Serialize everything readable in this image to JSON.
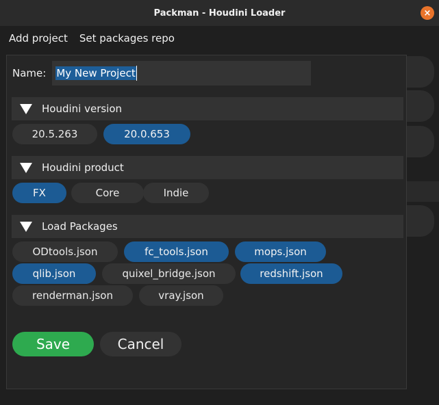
{
  "window": {
    "title": "Packman - Houdini Loader",
    "close_glyph": "×"
  },
  "menu": {
    "items": [
      "Add project",
      "Set packages repo"
    ]
  },
  "form": {
    "name_label": "Name:",
    "name_value": "My New Project"
  },
  "sections": {
    "version": {
      "title": "Houdini version",
      "options": [
        {
          "label": "20.5.263",
          "selected": false
        },
        {
          "label": "20.0.653",
          "selected": true
        }
      ]
    },
    "product": {
      "title": "Houdini product",
      "options": [
        {
          "label": "FX",
          "selected": true
        },
        {
          "label": "Core",
          "selected": false
        },
        {
          "label": "Indie",
          "selected": false
        }
      ]
    },
    "packages": {
      "title": "Load Packages",
      "options": [
        {
          "label": "ODtools.json",
          "selected": false
        },
        {
          "label": "fc_tools.json",
          "selected": true
        },
        {
          "label": "mops.json",
          "selected": true
        },
        {
          "label": "qlib.json",
          "selected": true
        },
        {
          "label": "quixel_bridge.json",
          "selected": false
        },
        {
          "label": "redshift.json",
          "selected": true
        },
        {
          "label": "renderman.json",
          "selected": false
        },
        {
          "label": "vray.json",
          "selected": false
        }
      ]
    }
  },
  "actions": {
    "save_label": "Save",
    "cancel_label": "Cancel"
  },
  "colors": {
    "accent_selected": "#1c5b94",
    "save_green": "#2eaa4f",
    "close_orange": "#e9742b"
  }
}
